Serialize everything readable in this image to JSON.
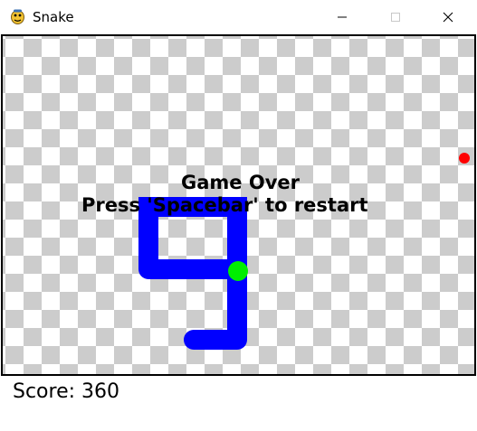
{
  "window": {
    "title": "Snake",
    "icon": "python-icon",
    "controls": {
      "minimize_icon": "minimize-icon",
      "maximize_icon": "maximize-icon",
      "close_icon": "close-icon"
    }
  },
  "game": {
    "over_title": "Game Over",
    "restart_prompt": "Press 'Spacebar' to restart",
    "score_label": "Score:",
    "score_value": "360",
    "colors": {
      "snake": "#0000ff",
      "snake_head": "#00ee00",
      "food": "#ff0000",
      "checker_dark": "#cccccc",
      "checker_light": "#ffffff",
      "border": "#000000"
    }
  }
}
